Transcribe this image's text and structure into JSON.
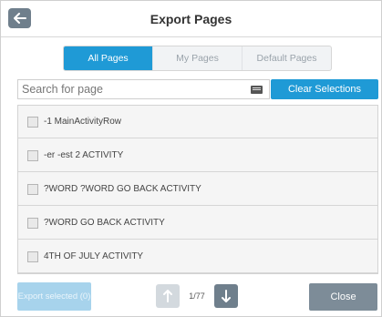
{
  "header": {
    "title": "Export Pages",
    "back_icon": "arrow-left-icon"
  },
  "tabs": [
    {
      "label": "All Pages",
      "active": true
    },
    {
      "label": "My Pages",
      "active": false
    },
    {
      "label": "Default Pages",
      "active": false
    }
  ],
  "search": {
    "placeholder": "Search for page",
    "value": "",
    "keyboard_icon": "keyboard-icon"
  },
  "clear_button": {
    "label": "Clear Selections"
  },
  "list": {
    "items": [
      {
        "label": "-1 MainActivityRow",
        "checked": false
      },
      {
        "label": "-er -est 2 ACTIVITY",
        "checked": false
      },
      {
        "label": "?WORD ?WORD GO BACK ACTIVITY",
        "checked": false
      },
      {
        "label": "?WORD GO BACK ACTIVITY",
        "checked": false
      },
      {
        "label": "4TH OF JULY ACTIVITY",
        "checked": false
      }
    ]
  },
  "footer": {
    "export_label": "Export selected (0)",
    "page_indicator": "1/77",
    "up_icon": "arrow-up-icon",
    "down_icon": "arrow-down-icon",
    "close_label": "Close"
  },
  "colors": {
    "accent": "#1f9ad6",
    "button_dark": "#6f7f8c",
    "button_disabled": "#a7d3ec",
    "close_button": "#7d8c98"
  }
}
